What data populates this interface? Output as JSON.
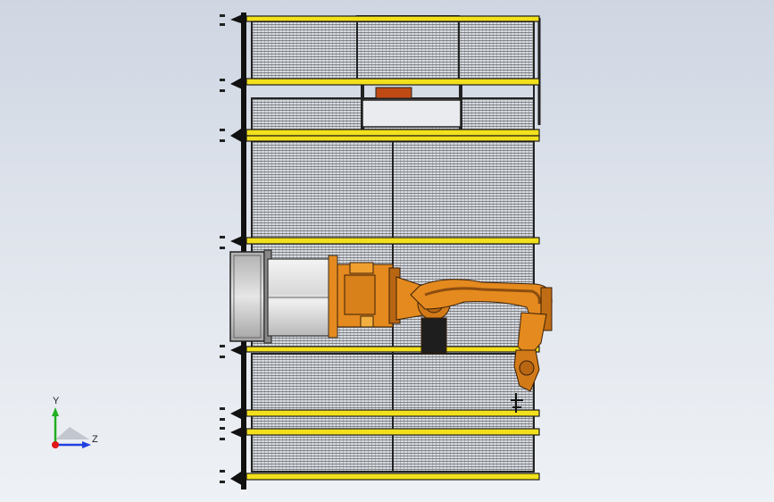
{
  "viewport": {
    "background_top": "#cfd6e2",
    "background_bottom": "#eef1f5"
  },
  "colors": {
    "guard_rail": "#f2e01c",
    "rail_edge": "#1c1c1c",
    "mesh_line": "#3a3a3a",
    "frame": "#222222",
    "robot_orange": "#e48a1e",
    "robot_dark_orange": "#b86612",
    "robot_shadow": "#8c4d10",
    "cylinder": "#e8e8e8",
    "base_gray": "#9c9c9c"
  },
  "triad": {
    "y_label": "Y",
    "z_label": "Z",
    "x_color": "#e01818",
    "y_color": "#20b020",
    "z_color": "#2040e0"
  },
  "icons": [
    "coordinate-triad-icon"
  ]
}
